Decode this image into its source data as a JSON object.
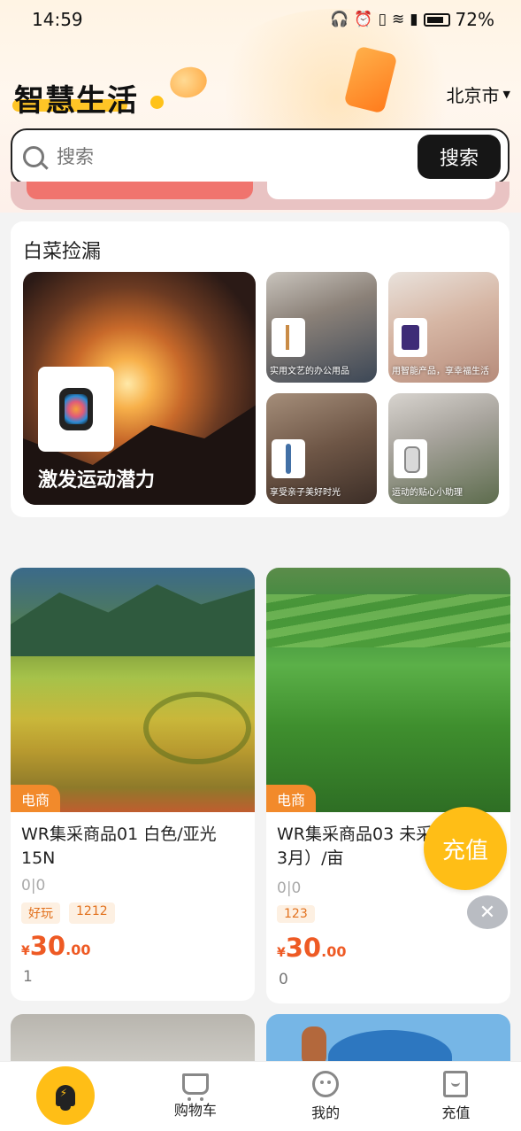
{
  "status_bar": {
    "time": "14:59",
    "battery": "72%",
    "icons": [
      "headphones-icon",
      "alarm-icon",
      "vibrate-icon",
      "wifi-icon",
      "signal-icon",
      "battery-icon"
    ]
  },
  "header": {
    "brand": "智慧生活",
    "city": "北京市"
  },
  "search": {
    "placeholder": "搜索",
    "button": "搜索"
  },
  "bargains": {
    "title": "白菜捡漏",
    "big_tile": {
      "caption": "激发运动潜力"
    },
    "tiles": [
      {
        "caption": "实用文艺的办公用品"
      },
      {
        "caption": "用智能产品，享幸福生活"
      },
      {
        "caption": "享受亲子美好时光"
      },
      {
        "caption": "运动的贴心小助理"
      }
    ]
  },
  "products": [
    {
      "tag": "电商",
      "name": "WR集采商品01 白色/亚光15N",
      "meta": "0|0",
      "chips": [
        "好玩",
        "1212"
      ],
      "price_symbol": "¥",
      "price_int": "30",
      "price_dec": ".00",
      "sold": "1"
    },
    {
      "tag": "电商",
      "name": "WR集采商品03 未采季度（1-3月）/亩",
      "meta": "0|0",
      "chips": [
        "123"
      ],
      "price_symbol": "¥",
      "price_int": "30",
      "price_dec": ".00",
      "sold": "0"
    }
  ],
  "fab": {
    "recharge": "充值",
    "close": "✕"
  },
  "tabbar": [
    {
      "label": ""
    },
    {
      "label": "购物车"
    },
    {
      "label": "我的"
    },
    {
      "label": "充值"
    }
  ],
  "colors": {
    "accent": "#ffbe16",
    "price": "#ee5a24",
    "tag": "#f28a2b"
  }
}
